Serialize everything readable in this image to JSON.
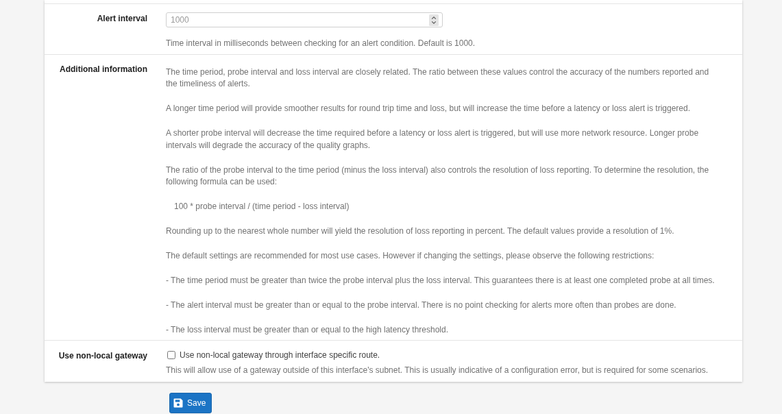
{
  "rows": [
    {
      "kind": "number",
      "label": "Alert interval",
      "placeholder": "1000",
      "help": "Time interval in milliseconds between checking for an alert condition. Default is 1000."
    },
    {
      "kind": "info",
      "label": "Additional information",
      "paragraphs": [
        {
          "kind": "text",
          "text": "The time period, probe interval and loss interval are closely related. The ratio between these values control the accuracy of the numbers reported and the timeliness of alerts."
        },
        {
          "kind": "text",
          "text": "A longer time period will provide smoother results for round trip time and loss, but will increase the time before a latency or loss alert is triggered."
        },
        {
          "kind": "text",
          "text": "A shorter probe interval will decrease the time required before a latency or loss alert is triggered, but will use more network resource. Longer probe intervals will degrade the accuracy of the quality graphs."
        },
        {
          "kind": "text",
          "text": "The ratio of the probe interval to the time period (minus the loss interval) also controls the resolution of loss reporting. To determine the resolution, the following formula can be used:"
        },
        {
          "kind": "formula",
          "text": "100 * probe interval / (time period - loss interval)"
        },
        {
          "kind": "text",
          "text": "Rounding up to the nearest whole number will yield the resolution of loss reporting in percent. The default values provide a resolution of 1%."
        },
        {
          "kind": "text",
          "text": "The default settings are recommended for most use cases. However if changing the settings, please observe the following restrictions:"
        },
        {
          "kind": "text",
          "text": "- The time period must be greater than twice the probe interval plus the loss interval. This guarantees there is at least one completed probe at all times."
        },
        {
          "kind": "text",
          "text": "- The alert interval must be greater than or equal to the probe interval. There is no point checking for alerts more often than probes are done."
        },
        {
          "kind": "text",
          "text": "- The loss interval must be greater than or equal to the high latency threshold."
        }
      ]
    },
    {
      "kind": "checkbox",
      "label": "Use non-local gateway",
      "checkbox_label": "Use non-local gateway through interface specific route.",
      "checked": false,
      "help": "This will allow use of a gateway outside of this interface's subnet. This is usually indicative of a configuration error, but is required for some scenarios."
    }
  ],
  "save_button": {
    "label": "Save"
  }
}
